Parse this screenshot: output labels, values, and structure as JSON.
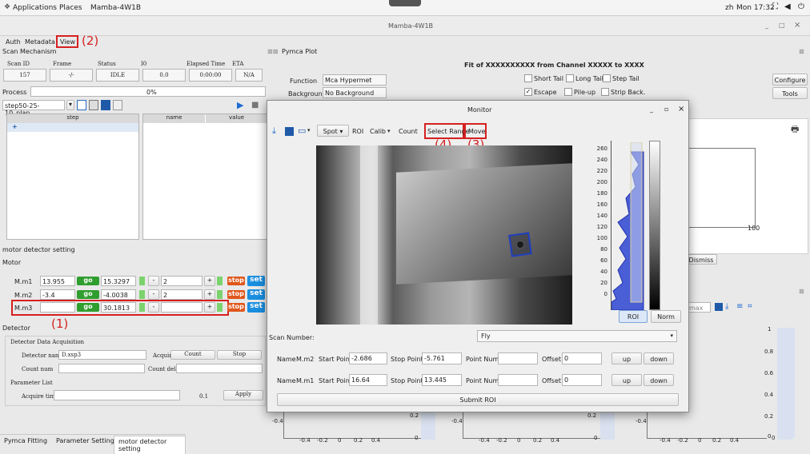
{
  "topbar": {
    "applications": "Applications",
    "places": "Places",
    "app_name": "Mamba-4W1B",
    "user": "zh",
    "clock": "Mon 17:32"
  },
  "window": {
    "title": "Mamba-4W1B",
    "min": "_",
    "max": "□",
    "close": "×"
  },
  "menu": {
    "auth": "Auth",
    "metadata": "Metadata",
    "view": "View"
  },
  "annotations": {
    "view": "(2)",
    "select_range": "(4)",
    "move": "(3)",
    "motor_m3": "(1)"
  },
  "scan": {
    "section": "Scan Mechanism",
    "headers": [
      "Scan ID",
      "Frame",
      "Status",
      "I0",
      "Elapsed Time",
      "ETA"
    ],
    "values": [
      "157",
      "-/-",
      "IDLE",
      "0.0",
      "0:00:00",
      "N/A"
    ],
    "process_label": "Process",
    "process_pct": "0%",
    "plan": "step50-25-10_plan",
    "table_headers": [
      "step",
      "name",
      "value"
    ],
    "add_symbol": "+"
  },
  "pymca": {
    "title": "Pymca Plot",
    "function_label": "Function",
    "function_value": "Mca Hypermet",
    "background_label": "Background",
    "background_value": "No Background",
    "fit_title": "Fit of XXXXXXXXXX from Channel XXXXX to XXXX",
    "options": [
      "Short Tail",
      "Long Tail",
      "Step Tail",
      "Escape",
      "Pile-up",
      "Strip Back."
    ],
    "configure": "Configure",
    "tools": "Tools",
    "axis_100": "100",
    "dismiss": "Dismiss",
    "max_placeholder": "max"
  },
  "motor": {
    "section": "motor detector setting",
    "label": "Motor",
    "rows": [
      {
        "name": "M.m1",
        "target": "13.955",
        "go": "go",
        "current": "15.3297",
        "minus": "-",
        "step": "2",
        "plus": "+",
        "stop": "stop",
        "set": "set"
      },
      {
        "name": "M.m2",
        "target": "-3.4",
        "go": "go",
        "current": "-4.0038",
        "minus": "-",
        "step": "2",
        "plus": "+",
        "stop": "stop",
        "set": "set"
      },
      {
        "name": "M.m3",
        "target": "",
        "go": "go",
        "current": "30.1813",
        "minus": "-",
        "step": "",
        "plus": "+",
        "stop": "stop",
        "set": "set"
      }
    ]
  },
  "detector": {
    "section": "Detector",
    "daq": "Detector Data Acquisition",
    "name_label": "Detector name",
    "name_value": "D.xsp3",
    "acquire_label": "Acquire",
    "count_btn": "Count",
    "stop_btn": "Stop",
    "count_num": "Count num",
    "count_delay": "Count delay",
    "param_list": "Parameter List",
    "acquire_time": "Acquire time",
    "acq_value": "0.1",
    "apply": "Apply"
  },
  "bottom_tabs": [
    "Pymca Fitting",
    "Parameter Setting",
    "motor detector setting"
  ],
  "monitor": {
    "title": "Monitor",
    "spot": "Spot",
    "roi": "ROI",
    "calib": "Calib",
    "count": "Count",
    "select_range": "Select Range",
    "move": "Move",
    "hist_ticks": [
      "260",
      "240",
      "220",
      "200",
      "180",
      "160",
      "140",
      "120",
      "100",
      "80",
      "60",
      "40",
      "20",
      "0"
    ],
    "roi_btn": "ROI",
    "norm_btn": "Norm",
    "scan_number_label": "Scan Number:",
    "scan_number_value": "Fly",
    "rows": [
      {
        "name": "Name",
        "motor": "M.m2",
        "start_label": "Start Point",
        "start": "-2.686",
        "stop_label": "Stop Point",
        "stop": "-5.761",
        "pn_label": "Point Num",
        "pn": "",
        "off_label": "Offset",
        "off": "0",
        "up": "up",
        "down": "down"
      },
      {
        "name": "Name",
        "motor": "M.m1",
        "start_label": "Start Point",
        "start": "16.64",
        "stop_label": "Stop Point",
        "stop": "13.445",
        "pn_label": "Point Num",
        "pn": "",
        "off_label": "Offset",
        "off": "0",
        "up": "up",
        "down": "down"
      }
    ],
    "submit": "Submit ROI"
  },
  "plots": {
    "ticks_x": [
      "-0.4",
      "-0.2",
      "0",
      "0.2",
      "0.4"
    ],
    "tick_y_neg": "-0.4",
    "tick_y_02": "0.2",
    "zero": "0",
    "right_ticks": [
      "1",
      "0.8",
      "0.6",
      "0.4",
      "0.2",
      "0"
    ]
  }
}
